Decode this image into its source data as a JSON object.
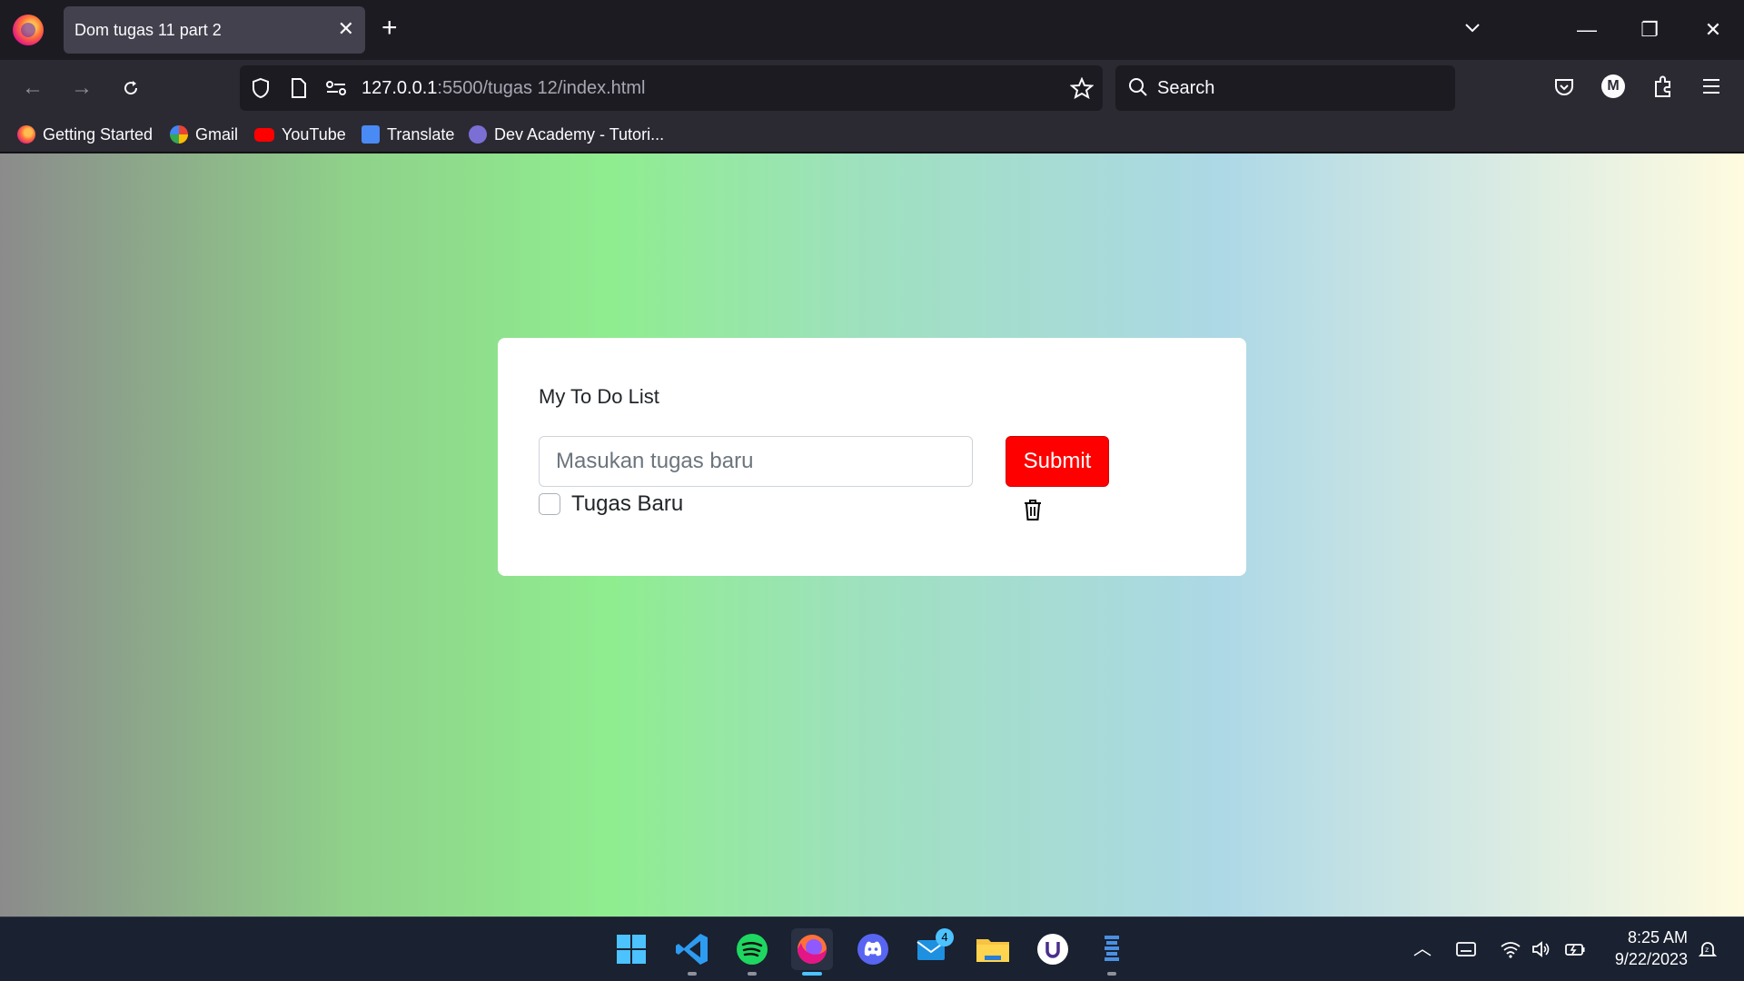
{
  "browser": {
    "tab": {
      "title": "Dom tugas 11 part 2",
      "close_glyph": "✕"
    },
    "new_tab_glyph": "+",
    "window_controls": {
      "minimize": "—",
      "restore": "❐",
      "close": "✕"
    },
    "url": {
      "host": "127.0.0.1",
      "rest": ":5500/tugas 12/index.html"
    },
    "search_placeholder": "Search",
    "profile_initial": "M",
    "bookmarks": [
      {
        "label": "Getting Started",
        "icon": "firefox-icon"
      },
      {
        "label": "Gmail",
        "icon": "google-icon"
      },
      {
        "label": "YouTube",
        "icon": "youtube-icon"
      },
      {
        "label": "Translate",
        "icon": "translate-icon"
      },
      {
        "label": "Dev Academy - Tutori...",
        "icon": "dev-academy-icon"
      }
    ]
  },
  "page": {
    "title": "My To Do List",
    "input_placeholder": "Masukan tugas baru",
    "input_value": "",
    "submit_label": "Submit",
    "tasks": [
      {
        "label": "Tugas Baru",
        "done": false
      }
    ]
  },
  "taskbar": {
    "apps": [
      "windows-start",
      "vscode",
      "spotify",
      "firefox",
      "discord",
      "mail",
      "file-explorer",
      "upwork",
      "app"
    ],
    "active_app": "firefox",
    "mail_badge": "4",
    "time": "8:25 AM",
    "date": "9/22/2023"
  },
  "colors": {
    "submit_bg": "#ff0000",
    "tab_bg": "#42414d",
    "chrome_bg": "#2b2a33",
    "taskbar_bg": "#1a2130"
  }
}
